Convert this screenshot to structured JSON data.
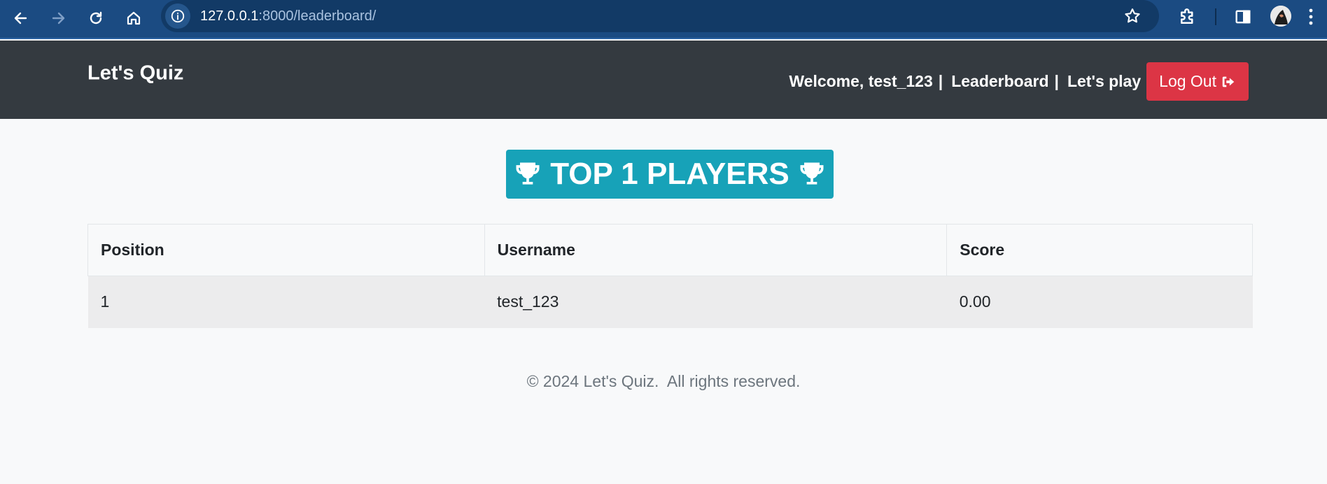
{
  "browser": {
    "url_host": "127.0.0.1",
    "url_rest": ":8000/leaderboard/",
    "icons": {
      "back": "back-arrow-icon",
      "forward": "forward-arrow-icon",
      "reload": "reload-icon",
      "home": "home-icon",
      "site_info": "info-icon",
      "bookmark": "star-icon",
      "extensions": "puzzle-icon",
      "side_panel": "side-panel-icon",
      "menu": "kebab-menu-icon"
    }
  },
  "navbar": {
    "brand": "Let's Quiz",
    "welcome": "Welcome, test_123",
    "separator": "|",
    "links": [
      "Leaderboard",
      "Let's play"
    ],
    "logout_label": "Log Out",
    "logout_icon": "sign-out-icon"
  },
  "banner": {
    "title": "TOP 1 PLAYERS",
    "icon": "trophy-icon"
  },
  "leaderboard": {
    "headers": [
      "Position",
      "Username",
      "Score"
    ],
    "rows": [
      [
        "1",
        "test_123",
        "0.00"
      ]
    ]
  },
  "footer": {
    "text": "© 2024 Let's Quiz.  All rights reserved."
  },
  "colors": {
    "browser_bar": "#1b4b82",
    "navbar": "#343a40",
    "banner": "#17a2b8",
    "logout": "#dc3545",
    "page_bg": "#f8f9fa"
  }
}
